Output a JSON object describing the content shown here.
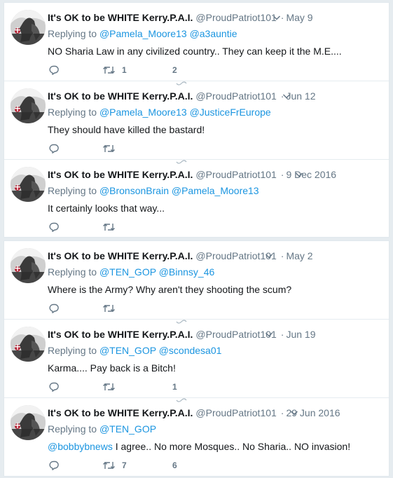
{
  "colors": {
    "link": "#1b95e0",
    "muted": "#657786",
    "text": "#14171a",
    "divider": "#e6ecf0"
  },
  "tweets": [
    {
      "name": "It's OK to be WHITE Kerry.P.A.I.",
      "handle": "@ProudPatriot101",
      "dot": "·",
      "time": "May 9",
      "replying_prefix": "Replying to",
      "mentions": [
        "@Pamela_Moore13",
        "@a3auntie"
      ],
      "text": "NO Sharia Law in any civilized country.. They can keep it the M.E....",
      "retweets": "1",
      "likes": "2",
      "avatar_label": "BRITAIN"
    },
    {
      "name": "It's OK to be WHITE Kerry.P.A.I.",
      "handle": "@ProudPatriot101",
      "dot": "·",
      "time": "Jun 12",
      "replying_prefix": "Replying to",
      "mentions": [
        "@Pamela_Moore13",
        "@JusticeFrEurope"
      ],
      "text": "They should have killed the bastard!",
      "retweets": "",
      "likes": "",
      "avatar_label": "BRITAIN"
    },
    {
      "name": "It's OK to be WHITE Kerry.P.A.I.",
      "handle": "@ProudPatriot101",
      "dot": "·",
      "time": "9 Dec 2016",
      "replying_prefix": "Replying to",
      "mentions": [
        "@BronsonBrain",
        "@Pamela_Moore13"
      ],
      "text": "It certainly looks that way...",
      "retweets": "",
      "likes": "",
      "avatar_label": "BRITAIN"
    },
    {
      "name": "It's OK to be WHITE Kerry.P.A.I.",
      "handle": "@ProudPatriot101",
      "dot": "·",
      "time": "May 2",
      "replying_prefix": "Replying to",
      "mentions": [
        "@TEN_GOP",
        "@Binnsy_46"
      ],
      "text": "Where is the Army? Why aren't they shooting the scum?",
      "retweets": "",
      "likes": "",
      "avatar_label": "BRITAIN"
    },
    {
      "name": "It's OK to be WHITE Kerry.P.A.I.",
      "handle": "@ProudPatriot101",
      "dot": "·",
      "time": "Jun 19",
      "replying_prefix": "Replying to",
      "mentions": [
        "@TEN_GOP",
        "@scondesa01"
      ],
      "text": "Karma.... Pay back is a Bitch!",
      "retweets": "",
      "likes": "1",
      "avatar_label": "BRITAIN"
    },
    {
      "name": "It's OK to be WHITE Kerry.P.A.I.",
      "handle": "@ProudPatriot101",
      "dot": "·",
      "time": "29 Jun 2016",
      "replying_prefix": "Replying to",
      "mentions": [
        "@TEN_GOP"
      ],
      "text_mention": "@bobbybnews",
      "text": " I agree.. No more Mosques.. No Sharia.. NO invasion!",
      "retweets": "7",
      "likes": "6",
      "avatar_label": "BRITAIN"
    }
  ]
}
